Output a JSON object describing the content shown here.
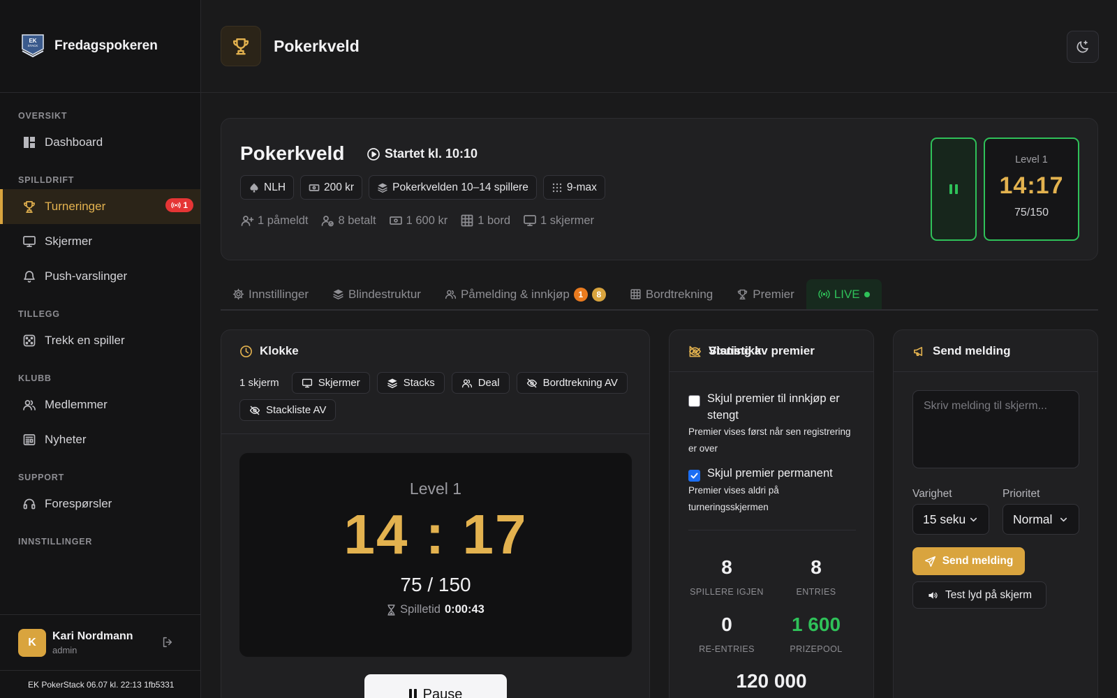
{
  "app": {
    "name": "Fredagspokeren",
    "logo_text_1": "EK",
    "logo_text_2": "STACK",
    "version": "EK PokerStack 06.07 kl. 22:13 1fb5331"
  },
  "sidebar": {
    "sections": [
      {
        "title": "OVERSIKT",
        "items": [
          {
            "label": "Dashboard",
            "icon": "dashboard-icon"
          }
        ]
      },
      {
        "title": "SPILLDRIFT",
        "items": [
          {
            "label": "Turneringer",
            "icon": "trophy-icon",
            "active": true,
            "badge": "1"
          },
          {
            "label": "Skjermer",
            "icon": "monitor-icon"
          },
          {
            "label": "Push-varslinger",
            "icon": "bell-icon"
          }
        ]
      },
      {
        "title": "TILLEGG",
        "items": [
          {
            "label": "Trekk en spiller",
            "icon": "dice-icon"
          }
        ]
      },
      {
        "title": "KLUBB",
        "items": [
          {
            "label": "Medlemmer",
            "icon": "users-icon"
          },
          {
            "label": "Nyheter",
            "icon": "newspaper-icon"
          }
        ]
      },
      {
        "title": "SUPPORT",
        "items": [
          {
            "label": "Forespørsler",
            "icon": "headset-icon"
          }
        ]
      },
      {
        "title": "INNSTILLINGER",
        "items": []
      }
    ]
  },
  "user": {
    "initial": "K",
    "name": "Kari Nordmann",
    "role": "admin"
  },
  "topbar": {
    "title": "Pokerkveld"
  },
  "tournament": {
    "title": "Pokerkveld",
    "started": "Startet kl. 10:10",
    "chips": [
      "NLH",
      "200 kr",
      "Pokerkvelden 10–14 spillere",
      "9-max"
    ],
    "stats": [
      "1 påmeldt",
      "8 betalt",
      "1 600 kr",
      "1 bord",
      "1 skjermer"
    ],
    "level_box": {
      "level": "Level 1",
      "time": "14:17",
      "blinds": "75/150"
    }
  },
  "tabs": [
    {
      "label": "Innstillinger",
      "icon": "gear-icon"
    },
    {
      "label": "Blindestruktur",
      "icon": "layers-icon"
    },
    {
      "label": "Påmelding & innkjøp",
      "icon": "users-icon",
      "counts": [
        "1",
        "8"
      ]
    },
    {
      "label": "Bordtrekning",
      "icon": "grid-icon"
    },
    {
      "label": "Premier",
      "icon": "trophy-icon"
    },
    {
      "label": "LIVE",
      "icon": "broadcast-icon",
      "active": true
    }
  ],
  "clock": {
    "title": "Klokke",
    "screens_label": "1 skjerm",
    "buttons": [
      "Skjermer",
      "Stacks",
      "Deal",
      "Bordtrekning AV",
      "Stackliste AV"
    ],
    "level": "Level 1",
    "time": "14 : 17",
    "blinds": "75 / 150",
    "playtime_label": "Spilletid",
    "playtime_value": "0:00:43",
    "pause_label": "Pause"
  },
  "prizes": {
    "title": "Visning av premier",
    "opt1_label": "Skjul premier til innkjøp er stengt",
    "opt1_help": "Premier vises først når sen registrering er over",
    "opt1_checked": false,
    "opt2_label": "Skjul premier permanent",
    "opt2_help": "Premier vises aldri på turneringsskjermen",
    "opt2_checked": true,
    "stats_title": "Statistikk",
    "stats": [
      {
        "value": "8",
        "label": "SPILLERE IGJEN"
      },
      {
        "value": "8",
        "label": "ENTRIES"
      },
      {
        "value": "0",
        "label": "RE-ENTRIES"
      },
      {
        "value": "1 600",
        "label": "PRIZEPOOL",
        "color": "#2fc159"
      }
    ],
    "partial_value": "120 000"
  },
  "message": {
    "title": "Send melding",
    "placeholder": "Skriv melding til skjerm...",
    "duration_label": "Varighet",
    "duration_value": "15 seku",
    "priority_label": "Prioritet",
    "priority_value": "Normal",
    "send_label": "Send melding",
    "test_label": "Test lyd på skjerm"
  },
  "colors": {
    "accent": "#d9a43e",
    "live": "#2fc159",
    "danger": "#e53535"
  }
}
